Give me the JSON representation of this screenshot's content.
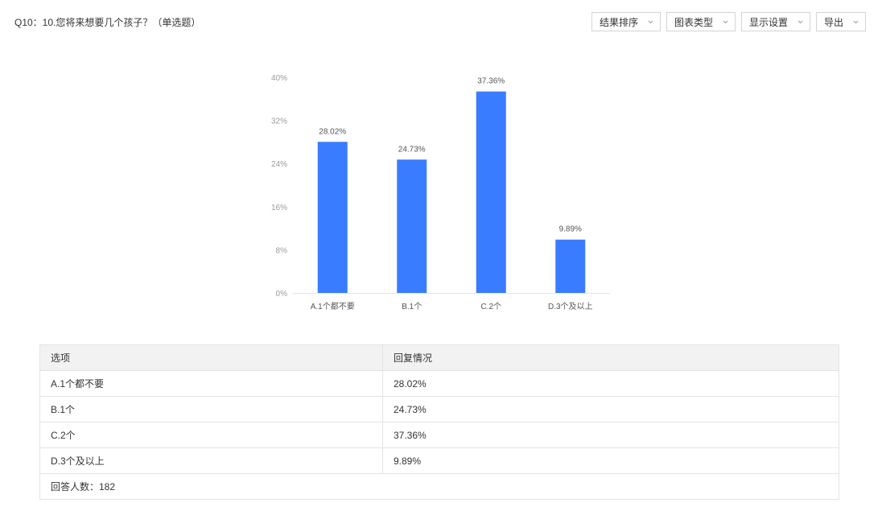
{
  "question": {
    "title": "Q10：10.您将来想要几个孩子？（单选题）"
  },
  "toolbar": {
    "buttons": [
      {
        "label": "结果排序"
      },
      {
        "label": "图表类型"
      },
      {
        "label": "显示设置"
      },
      {
        "label": "导出"
      }
    ]
  },
  "colors": {
    "bar": "#3a7cff",
    "axis_text": "#9b9b9b"
  },
  "chart_data": {
    "type": "bar",
    "categories": [
      "A.1个都不要",
      "B.1个",
      "C.2个",
      "D.3个及以上"
    ],
    "values": [
      28.02,
      24.73,
      37.36,
      9.89
    ],
    "value_labels": [
      "28.02%",
      "24.73%",
      "37.36%",
      "9.89%"
    ],
    "yticks": [
      "0%",
      "8%",
      "16%",
      "24%",
      "32%",
      "40%"
    ],
    "ylim": [
      0,
      40
    ],
    "grid": false
  },
  "table": {
    "headers": [
      "选项",
      "回复情况"
    ],
    "rows": [
      [
        "A.1个都不要",
        "28.02%"
      ],
      [
        "B.1个",
        "24.73%"
      ],
      [
        "C.2个",
        "37.36%"
      ],
      [
        "D.3个及以上",
        "9.89%"
      ]
    ],
    "footer": "回答人数：182"
  }
}
